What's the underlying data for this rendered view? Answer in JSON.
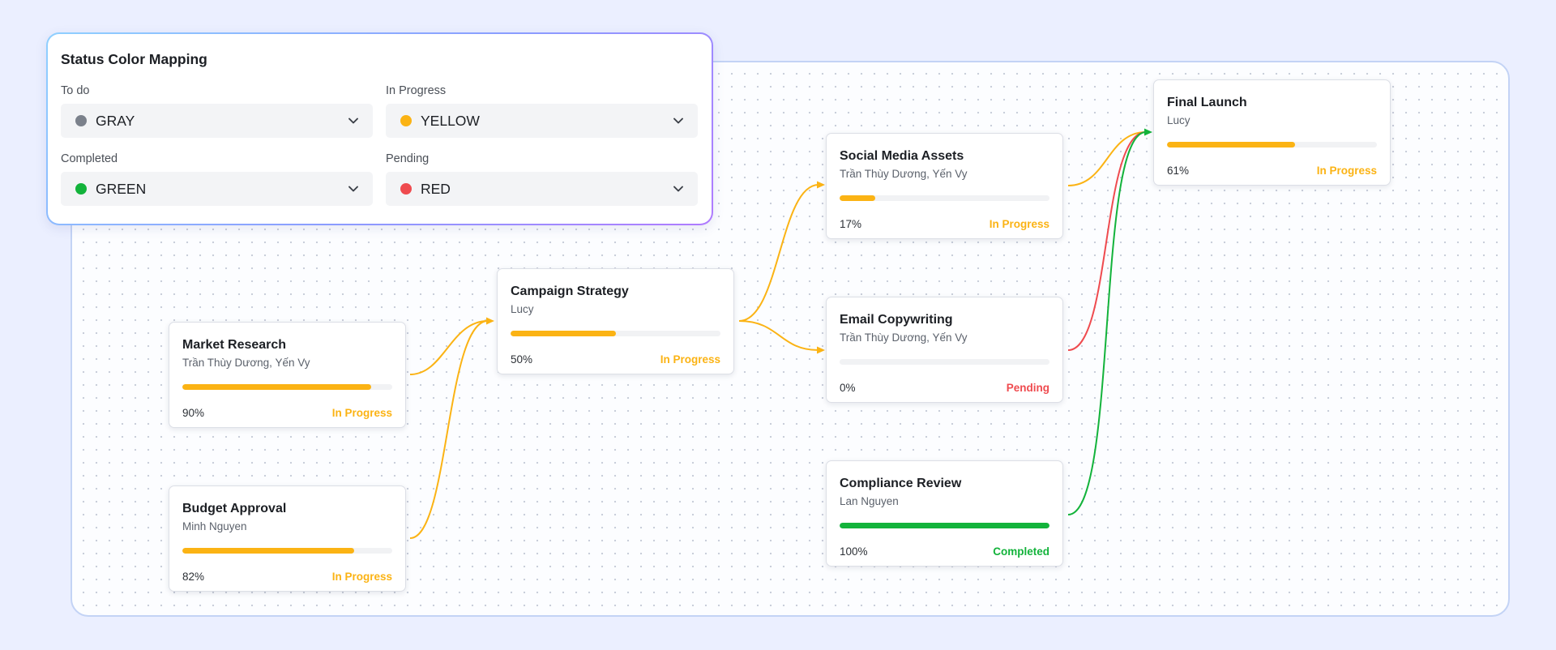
{
  "legend": {
    "title": "Status Color Mapping",
    "mappings": [
      {
        "label": "To do",
        "value": "GRAY",
        "color": "#7b818b"
      },
      {
        "label": "In Progress",
        "value": "YELLOW",
        "color": "#fbb314"
      },
      {
        "label": "Completed",
        "value": "GREEN",
        "color": "#13b33b"
      },
      {
        "label": "Pending",
        "value": "RED",
        "color": "#ef4b4f"
      }
    ]
  },
  "colors": {
    "in_progress": "#fbb314",
    "pending": "#ef4b4f",
    "completed": "#13b33b",
    "todo": "#7b818b"
  },
  "nodes": [
    {
      "id": "market-research",
      "title": "Market Research",
      "assignee": "Trần Thùy Dương, Yến Vy",
      "progress": 90,
      "pct_label": "90%",
      "status": "In Progress",
      "color": "#fbb314"
    },
    {
      "id": "budget-approval",
      "title": "Budget Approval",
      "assignee": "Minh Nguyen",
      "progress": 82,
      "pct_label": "82%",
      "status": "In Progress",
      "color": "#fbb314"
    },
    {
      "id": "campaign-strategy",
      "title": "Campaign Strategy",
      "assignee": "Lucy",
      "progress": 50,
      "pct_label": "50%",
      "status": "In Progress",
      "color": "#fbb314"
    },
    {
      "id": "social-media-assets",
      "title": "Social Media Assets",
      "assignee": "Trần Thùy Dương, Yến Vy",
      "progress": 17,
      "pct_label": "17%",
      "status": "In Progress",
      "color": "#fbb314"
    },
    {
      "id": "email-copywriting",
      "title": "Email Copywriting",
      "assignee": "Trần Thùy Dương, Yến Vy",
      "progress": 0,
      "pct_label": "0%",
      "status": "Pending",
      "color": "#ef4b4f"
    },
    {
      "id": "compliance-review",
      "title": "Compliance Review",
      "assignee": "Lan Nguyen",
      "progress": 100,
      "pct_label": "100%",
      "status": "Completed",
      "color": "#13b33b"
    },
    {
      "id": "final-launch",
      "title": "Final Launch",
      "assignee": "Lucy",
      "progress": 61,
      "pct_label": "61%",
      "status": "In Progress",
      "color": "#fbb314"
    }
  ],
  "edges": [
    {
      "from": "market-research",
      "to": "campaign-strategy",
      "color": "#fbb314"
    },
    {
      "from": "budget-approval",
      "to": "campaign-strategy",
      "color": "#fbb314"
    },
    {
      "from": "campaign-strategy",
      "to": "social-media-assets",
      "color": "#fbb314"
    },
    {
      "from": "campaign-strategy",
      "to": "email-copywriting",
      "color": "#fbb314"
    },
    {
      "from": "social-media-assets",
      "to": "final-launch",
      "color": "#fbb314"
    },
    {
      "from": "email-copywriting",
      "to": "final-launch",
      "color": "#ef4b4f"
    },
    {
      "from": "compliance-review",
      "to": "final-launch",
      "color": "#13b33b"
    }
  ]
}
